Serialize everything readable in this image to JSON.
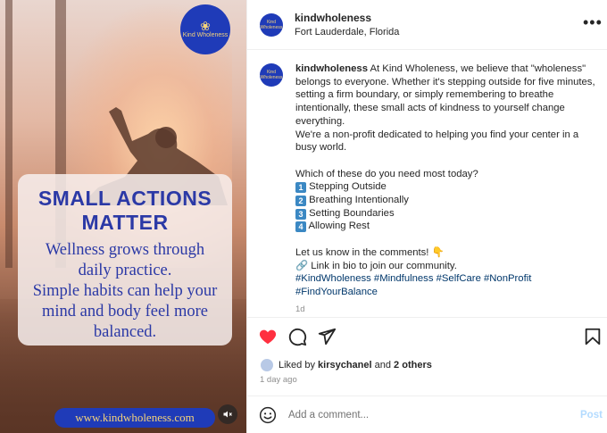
{
  "media": {
    "logo_text": "Kind Wholeness",
    "headline_line1": "SMALL ACTIONS",
    "headline_line2": "MATTER",
    "body_lines": [
      "Wellness grows through",
      "daily practice.",
      "Simple habits can help your",
      "mind and body feel more",
      "balanced."
    ],
    "url": "www.kindwholeness.com",
    "mute_icon": "speaker-muted-icon"
  },
  "header": {
    "username": "kindwholeness",
    "location": "Fort Lauderdale, Florida",
    "avatar_text": "Kind Wholeness"
  },
  "caption": {
    "username": "kindwholeness",
    "intro": " At Kind Wholeness, we believe that \"wholeness\" belongs to everyone. Whether it's stepping outside for five minutes, setting a firm boundary, or simply remembering to breathe intentionally, these small acts of kindness to yourself change everything.\nWe're a non-profit dedicated to helping you find your center in a busy world.\n\nWhich of these do you need most today?",
    "options": [
      {
        "num": "1",
        "label": "Stepping Outside"
      },
      {
        "num": "2",
        "label": "Breathing Intentionally"
      },
      {
        "num": "3",
        "label": "Setting Boundaries"
      },
      {
        "num": "4",
        "label": "Allowing Rest"
      }
    ],
    "cta": "Let us know in the comments! 👇",
    "link_line": "🔗 Link in bio to join our community.",
    "hashtags": "#KindWholeness #Mindfulness #SelfCare #NonProfit #FindYourBalance",
    "age": "1d"
  },
  "engagement": {
    "liked_prefix": "Liked by ",
    "liked_user": "kirsychanel",
    "liked_and": " and ",
    "liked_others": "2 others",
    "time_ago": "1 day ago"
  },
  "comment": {
    "placeholder": "Add a comment...",
    "post_label": "Post"
  },
  "colors": {
    "brand_blue": "#1f3bb8",
    "brand_gold": "#f3d27a",
    "like_red": "#ff3040",
    "hashtag": "#00376b",
    "post_disabled": "#b3dbff"
  }
}
